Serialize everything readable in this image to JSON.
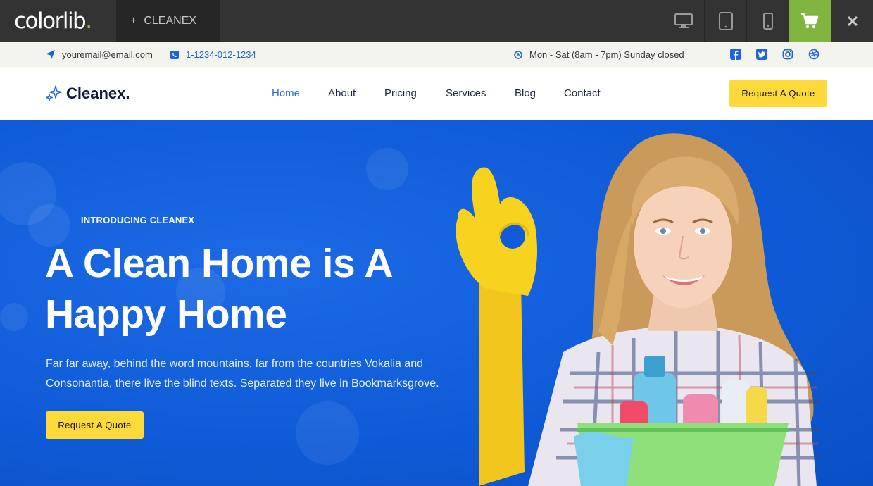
{
  "preview_bar": {
    "logo_main": "colorlib",
    "logo_dot": ".",
    "theme_tab_plus": "+",
    "theme_tab_label": "CLEANEX",
    "devices": [
      "desktop-icon",
      "tablet-icon",
      "mobile-icon"
    ],
    "cart_icon": "cart-icon",
    "close_icon": "close-icon",
    "accent": "#82b440"
  },
  "info_bar": {
    "email": "youremail@email.com",
    "phone": "1-1234-012-1234",
    "hours": "Mon - Sat (8am - 7pm) Sunday closed",
    "socials": [
      "facebook-icon",
      "twitter-icon",
      "instagram-icon",
      "dribbble-icon"
    ]
  },
  "nav": {
    "brand": "Cleanex.",
    "links": [
      "Home",
      "About",
      "Pricing",
      "Services",
      "Blog",
      "Contact"
    ],
    "active": "Home",
    "cta": "Request A Quote"
  },
  "hero": {
    "eyebrow": "INTRODUCING CLEANEX",
    "title_line1": "A Clean Home is A",
    "title_line2": "Happy Home",
    "description_line1": "Far far away, behind the word mountains, far from the countries Vokalia and",
    "description_line2": "Consonantia, there live the blind texts. Separated they live in Bookmarksgrove.",
    "cta": "Request A Quote"
  },
  "colors": {
    "hero_blue": "#0f5bd8",
    "cta_yellow": "#fdd93a",
    "nav_active": "#2a6ae0",
    "brand_dark": "#111a3a"
  }
}
